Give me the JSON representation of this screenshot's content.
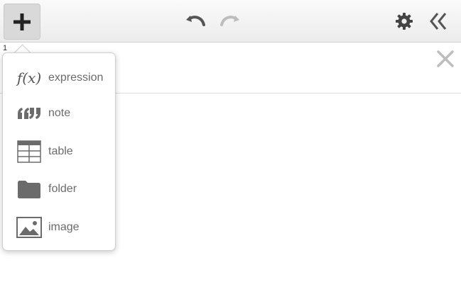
{
  "toolbar": {
    "add_icon": "plus-icon",
    "undo_icon": "undo-icon",
    "redo_icon": "redo-icon",
    "settings_icon": "gear-icon",
    "collapse_icon": "double-chevron-left-icon"
  },
  "expression_list": {
    "row_index": "1",
    "close_icon": "close-icon"
  },
  "add_menu": {
    "items": [
      {
        "label": "expression",
        "icon": "function-icon",
        "icon_text": "f(x)"
      },
      {
        "label": "note",
        "icon": "quote-icon"
      },
      {
        "label": "table",
        "icon": "table-icon"
      },
      {
        "label": "folder",
        "icon": "folder-icon"
      },
      {
        "label": "image",
        "icon": "image-icon"
      }
    ]
  },
  "colors": {
    "icon_dark": "#333333",
    "icon_gray": "#6b6b6b",
    "redo_disabled": "#bdbdbd",
    "close_gray": "#bdbdbd"
  }
}
